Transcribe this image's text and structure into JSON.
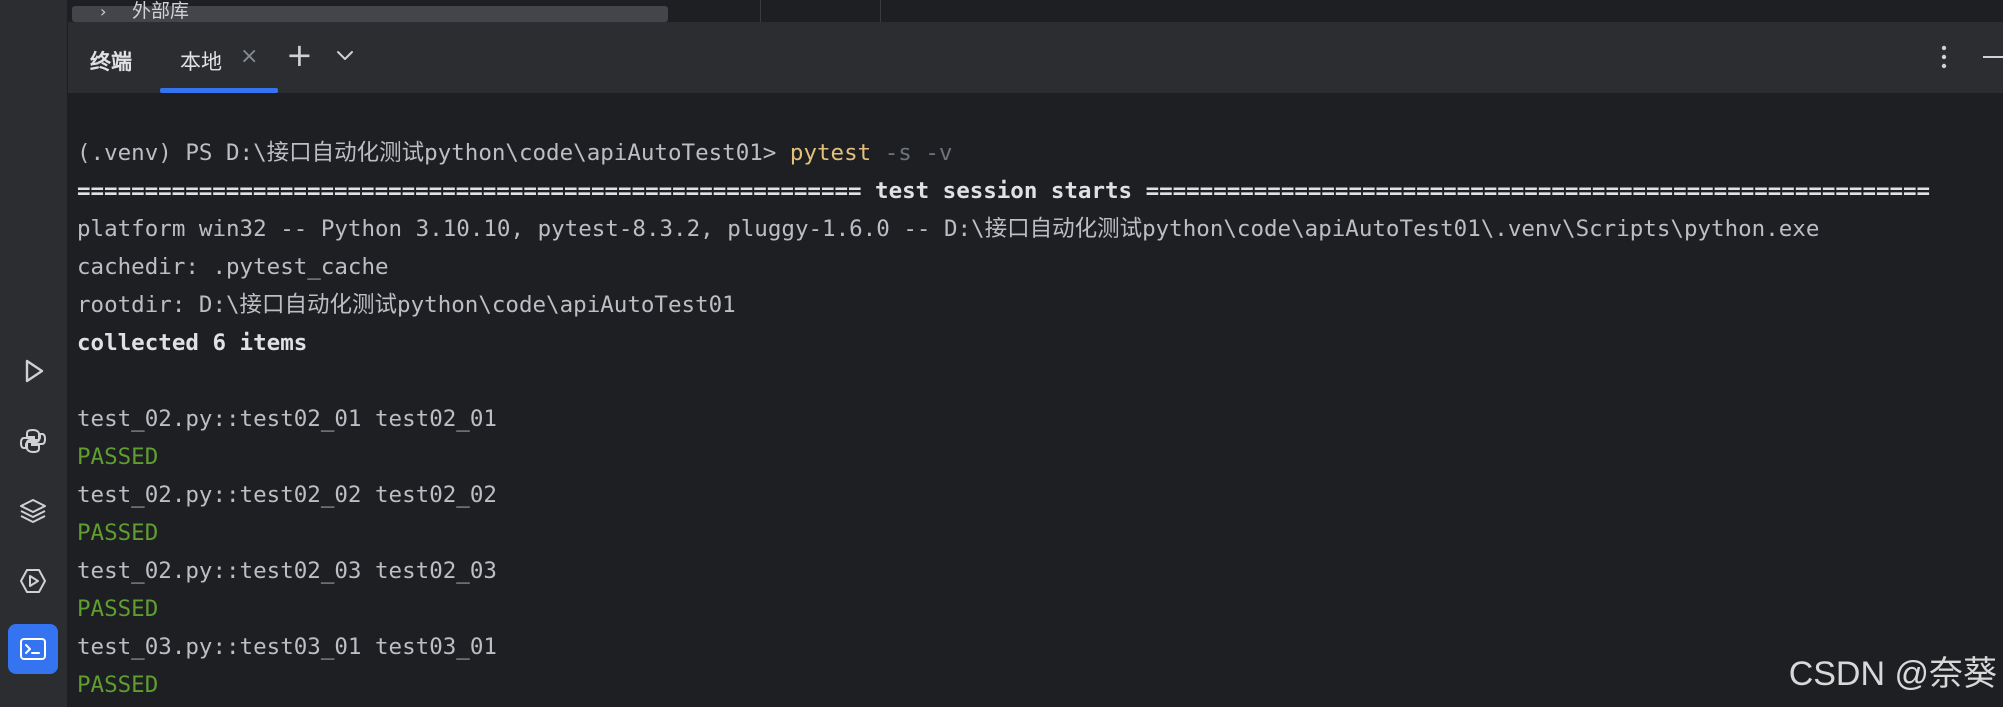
{
  "colors": {
    "background": "#1e1f22",
    "panel": "#2b2d30",
    "accent": "#3574f0",
    "command": "#e5c07b",
    "passed": "#5f9e2f",
    "text": "#bcbec4"
  },
  "tree": {
    "label": "外部库"
  },
  "toolstrip": {
    "icons": [
      "run-icon",
      "python-console-icon",
      "layers-icon",
      "services-icon",
      "terminal-icon"
    ]
  },
  "terminal": {
    "title": "终端",
    "tab_label": "本地",
    "tab_close": "×",
    "new_tab": "+",
    "lines": {
      "prompt": "(.venv) PS D:\\接口自动化测试python\\code\\apiAutoTest01> ",
      "command": "pytest",
      "flags": " -s -v",
      "session_start": "========================================================== test session starts ==========================================================",
      "platform": "platform win32 -- Python 3.10.10, pytest-8.3.2, pluggy-1.6.0 -- D:\\接口自动化测试python\\code\\apiAutoTest01\\.venv\\Scripts\\python.exe",
      "cachedir": "cachedir: .pytest_cache",
      "rootdir": "rootdir: D:\\接口自动化测试python\\code\\apiAutoTest01",
      "collected": "collected 6 items",
      "tests": [
        {
          "name": "test_02.py::test02_01 test02_01",
          "status": "PASSED"
        },
        {
          "name": "test_02.py::test02_02 test02_02",
          "status": "PASSED"
        },
        {
          "name": "test_02.py::test02_03 test02_03",
          "status": "PASSED"
        },
        {
          "name": "test_03.py::test03_01 test03_01",
          "status": "PASSED"
        }
      ]
    }
  },
  "watermark": "CSDN @奈葵"
}
